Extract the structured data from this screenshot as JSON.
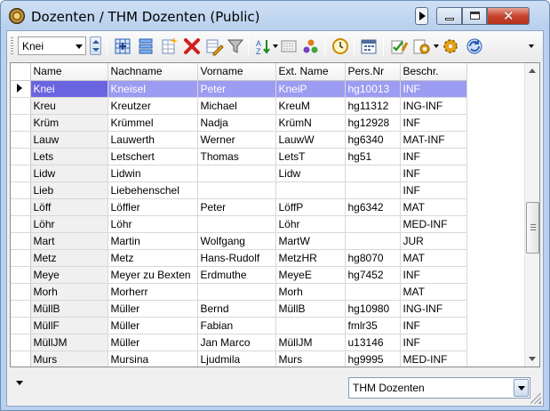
{
  "window": {
    "title": "Dozenten / THM Dozenten (Public)",
    "controls": {
      "minimize": "minimize",
      "maximize": "maximize",
      "close": "✕"
    }
  },
  "toolbar": {
    "combo_value": "Knei",
    "tools": [
      "grid-view-icon",
      "columns-icon",
      "new-record-icon",
      "delete-icon",
      "edit-icon",
      "filter-icon",
      "sort-icon",
      "fields-icon",
      "relations-icon",
      "clock-icon",
      "calendar-icon",
      "checklist-icon",
      "settings-icon",
      "gear-icon",
      "refresh-icon"
    ]
  },
  "table": {
    "columns": [
      "Name",
      "Nachname",
      "Vorname",
      "Ext. Name",
      "Pers.Nr",
      "Beschr."
    ],
    "rows": [
      [
        "Knei",
        "Kneisel",
        "Peter",
        "KneiP",
        "hg10013",
        "INF"
      ],
      [
        "Kreu",
        "Kreutzer",
        "Michael",
        "KreuM",
        "hg11312",
        "ING-INF"
      ],
      [
        "Krüm",
        "Krümmel",
        "Nadja",
        "KrümN",
        "hg12928",
        "INF"
      ],
      [
        "Lauw",
        "Lauwerth",
        "Werner",
        "LauwW",
        "hg6340",
        "MAT-INF"
      ],
      [
        "Lets",
        "Letschert",
        "Thomas",
        "LetsT",
        "hg51",
        "INF"
      ],
      [
        "Lidw",
        "Lidwin",
        "",
        "Lidw",
        "",
        "INF"
      ],
      [
        "Lieb",
        "Liebehenschel",
        "",
        "",
        "",
        "INF"
      ],
      [
        "Löff",
        "Löffler",
        "Peter",
        "LöffP",
        "hg6342",
        "MAT"
      ],
      [
        "Löhr",
        "Löhr",
        "",
        "Löhr",
        "",
        "MED-INF"
      ],
      [
        "Mart",
        "Martin",
        "Wolfgang",
        "MartW",
        "",
        "JUR"
      ],
      [
        "Metz",
        "Metz",
        "Hans-Rudolf",
        "MetzHR",
        "hg8070",
        "MAT"
      ],
      [
        "Meye",
        "Meyer zu Bexten",
        "Erdmuthe",
        "MeyeE",
        "hg7452",
        "INF"
      ],
      [
        "Morh",
        "Morherr",
        "",
        "Morh",
        "",
        "MAT"
      ],
      [
        "MüllB",
        "Müller",
        "Bernd",
        "MüllB",
        "hg10980",
        "ING-INF"
      ],
      [
        "MüllF",
        "Müller",
        "Fabian",
        "",
        "fmlr35",
        "INF"
      ],
      [
        "MüllJM",
        "Müller",
        "Jan Marco",
        "MüllJM",
        "u13146",
        "INF"
      ],
      [
        "Murs",
        "Mursina",
        "Ljudmila",
        "Murs",
        "hg9995",
        "MED-INF"
      ]
    ],
    "selected_row": 0
  },
  "status": {
    "selection": "THM Dozenten"
  },
  "colors": {
    "selected_row": "#9c9cf2",
    "selected_name": "#6b64e0",
    "close_button": "#c7452f",
    "titlebar": "#b9d1ee"
  }
}
